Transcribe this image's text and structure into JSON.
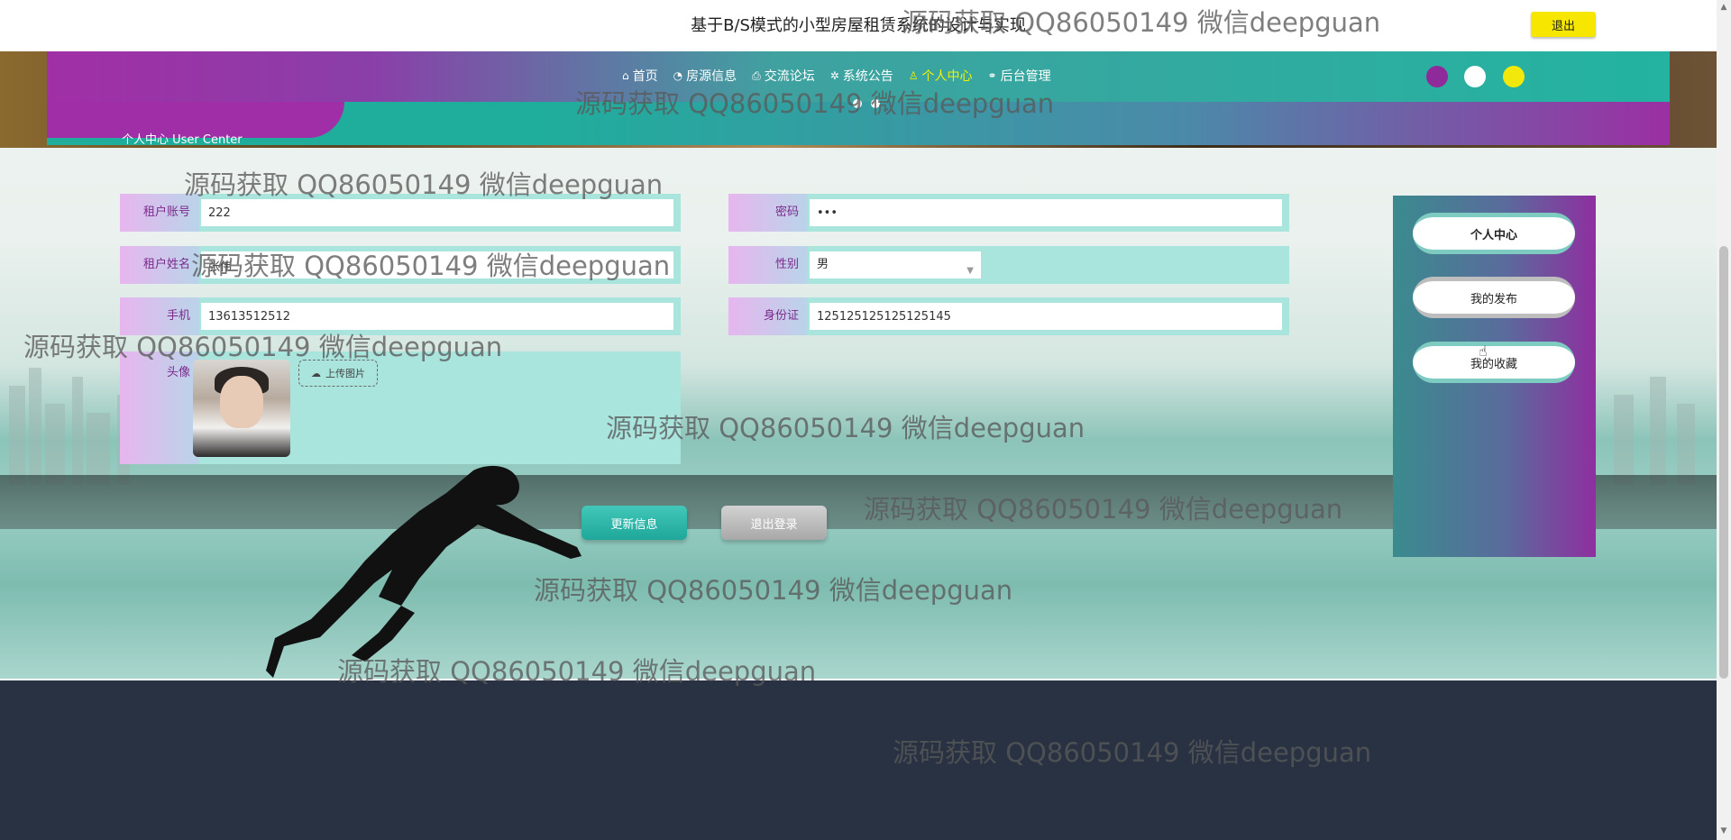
{
  "header": {
    "site_title": "基于B/S模式的小型房屋租赁系统的设计与实现",
    "logout_label": "退出"
  },
  "nav": {
    "items": [
      {
        "label": "首页",
        "icon": "home-icon"
      },
      {
        "label": "房源信息",
        "icon": "gauge-icon"
      },
      {
        "label": "交流论坛",
        "icon": "printer-icon"
      },
      {
        "label": "系统公告",
        "icon": "gear-icon"
      },
      {
        "label": "个人中心",
        "icon": "user-icon",
        "active": true
      },
      {
        "label": "后台管理",
        "icon": "link-icon"
      }
    ],
    "theme_colors": [
      "#8f2a9a",
      "#ffffff",
      "#f2e80c"
    ],
    "section_label": "个人中心 User Center"
  },
  "form": {
    "account": {
      "label": "租户账号",
      "value": "222"
    },
    "password": {
      "label": "密码",
      "value": "•••"
    },
    "name": {
      "label": "租户姓名",
      "value": "张伟"
    },
    "gender": {
      "label": "性别",
      "value": "男"
    },
    "phone": {
      "label": "手机",
      "value": "13613512512"
    },
    "idcard": {
      "label": "身份证",
      "value": "125125125125125145"
    },
    "avatar": {
      "label": "头像",
      "upload_label": "上传图片"
    },
    "update_label": "更新信息",
    "logout_label": "退出登录"
  },
  "sidebar": {
    "items": [
      "个人中心",
      "我的发布",
      "我的收藏"
    ]
  },
  "watermark": "源码获取 QQ86050149 微信deepguan"
}
